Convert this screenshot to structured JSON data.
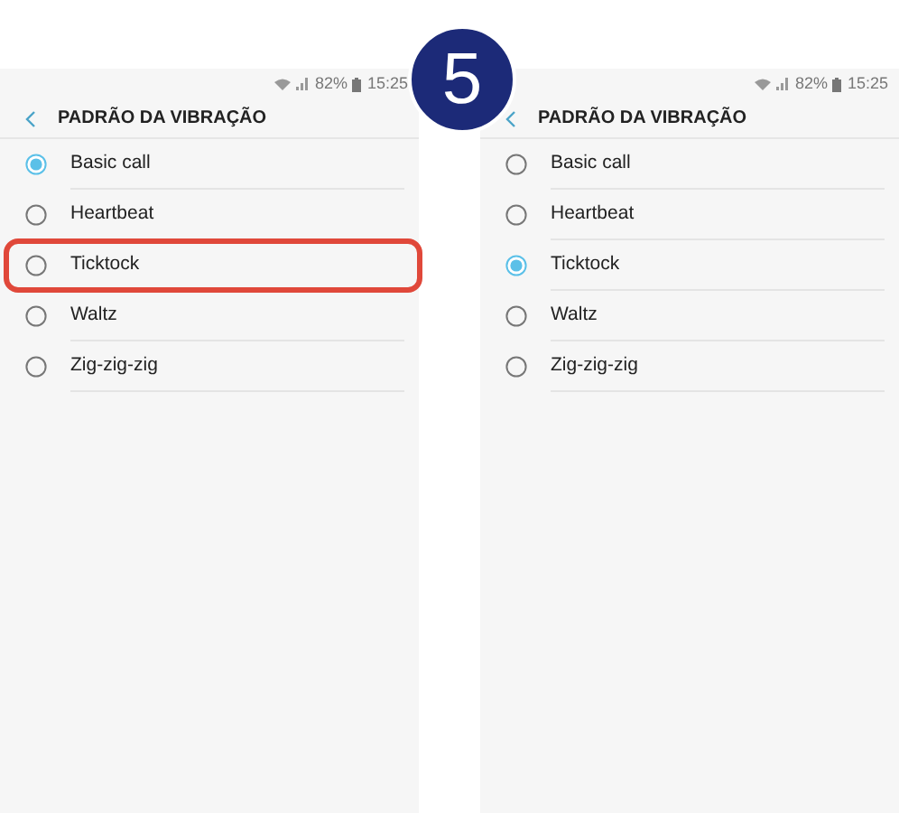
{
  "step_badge": "5",
  "screens": [
    {
      "status_bar": {
        "battery": "82%",
        "time": "15:25"
      },
      "title": "PADRÃO DA VIBRAÇÃO",
      "options": [
        {
          "label": "Basic call",
          "selected": true,
          "highlighted": false
        },
        {
          "label": "Heartbeat",
          "selected": false,
          "highlighted": false
        },
        {
          "label": "Ticktock",
          "selected": false,
          "highlighted": true
        },
        {
          "label": "Waltz",
          "selected": false,
          "highlighted": false
        },
        {
          "label": "Zig-zig-zig",
          "selected": false,
          "highlighted": false
        }
      ]
    },
    {
      "status_bar": {
        "battery": "82%",
        "time": "15:25"
      },
      "title": "PADRÃO DA VIBRAÇÃO",
      "options": [
        {
          "label": "Basic call",
          "selected": false,
          "highlighted": false
        },
        {
          "label": "Heartbeat",
          "selected": false,
          "highlighted": false
        },
        {
          "label": "Ticktock",
          "selected": true,
          "highlighted": false
        },
        {
          "label": "Waltz",
          "selected": false,
          "highlighted": false
        },
        {
          "label": "Zig-zig-zig",
          "selected": false,
          "highlighted": false
        }
      ]
    }
  ]
}
